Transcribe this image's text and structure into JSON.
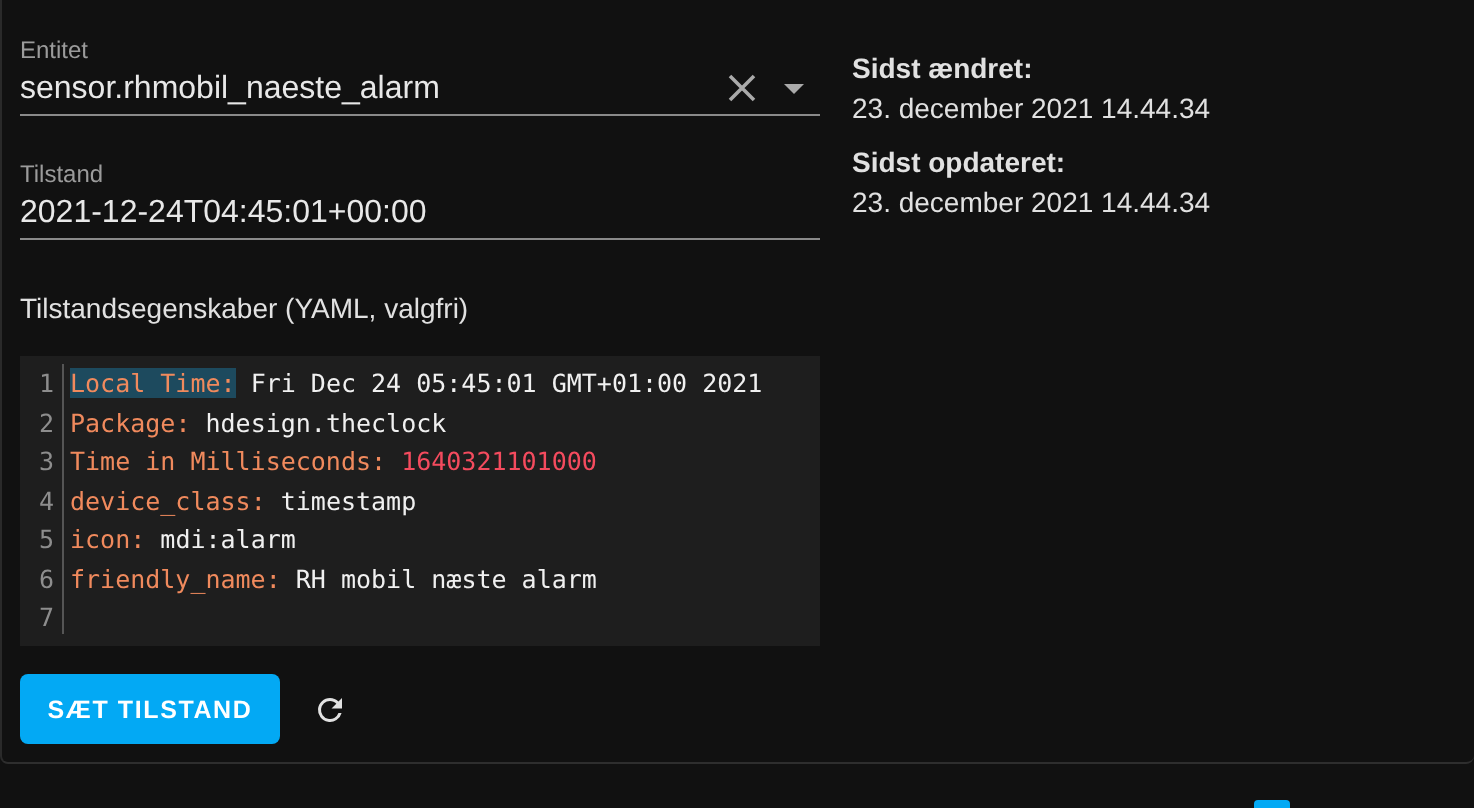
{
  "entity_field": {
    "label": "Entitet",
    "value": "sensor.rhmobil_naeste_alarm"
  },
  "state_field": {
    "label": "Tilstand",
    "value": "2021-12-24T04:45:01+00:00"
  },
  "attributes_label": "Tilstandsegenskaber (YAML, valgfri)",
  "code_lines": [
    {
      "number": "1",
      "key": "Local Time",
      "separator": ":",
      "value": "Fri Dec 24 05:45:01 GMT+01:00 2021",
      "kind": "string",
      "highlighted": true
    },
    {
      "number": "2",
      "key": "Package",
      "separator": ":",
      "value": "hdesign.theclock",
      "kind": "string",
      "highlighted": false
    },
    {
      "number": "3",
      "key": "Time in Milliseconds",
      "separator": ":",
      "value": "1640321101000",
      "kind": "number",
      "highlighted": false
    },
    {
      "number": "4",
      "key": "device_class",
      "separator": ":",
      "value": "timestamp",
      "kind": "string",
      "highlighted": false
    },
    {
      "number": "5",
      "key": "icon",
      "separator": ":",
      "value": "mdi:alarm",
      "kind": "string",
      "highlighted": false
    },
    {
      "number": "6",
      "key": "friendly_name",
      "separator": ":",
      "value": "RH mobil næste alarm",
      "kind": "string",
      "highlighted": false
    },
    {
      "number": "7",
      "highlighted": false
    }
  ],
  "set_button": "SÆT TILSTAND",
  "info": [
    {
      "label": "Sidst ændret:",
      "value": "23. december 2021 14.44.34"
    },
    {
      "label": "Sidst opdateret:",
      "value": "23. december 2021 14.44.34"
    }
  ]
}
